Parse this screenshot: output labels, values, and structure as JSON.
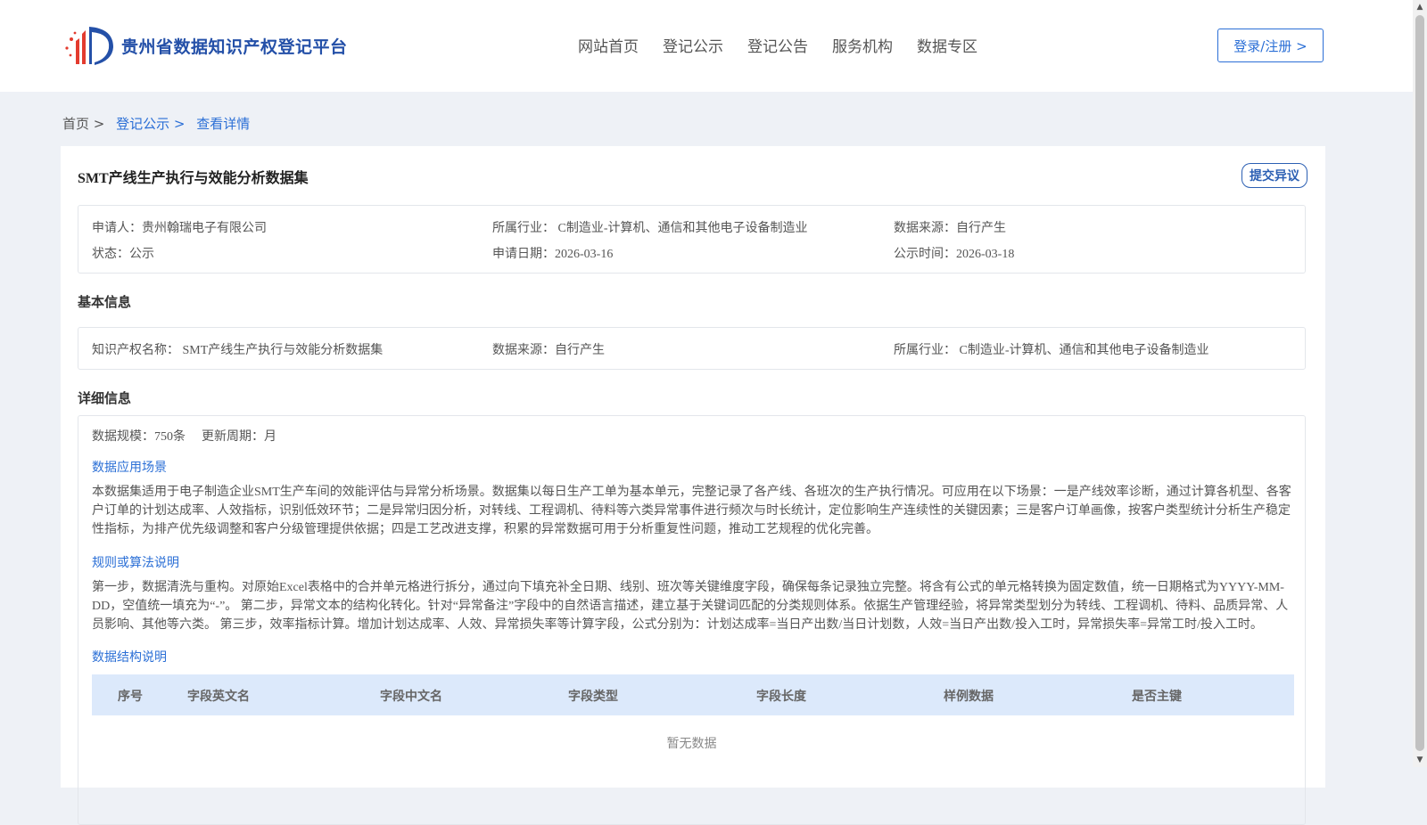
{
  "header": {
    "logo_text": "贵州省数据知识产权登记平台",
    "nav": [
      "网站首页",
      "登记公示",
      "登记公告",
      "服务机构",
      "数据专区"
    ],
    "login_label": "登录/注册 >"
  },
  "breadcrumb": {
    "home": "首页 >",
    "section": "登记公示 >",
    "current": "查看详情"
  },
  "record": {
    "title": "SMT产线生产执行与效能分析数据集",
    "objection_label": "提交异议",
    "summary": {
      "applicant": "申请人：贵州翰瑞电子有限公司",
      "industry": "所属行业： C制造业-计算机、通信和其他电子设备制造业",
      "source": "数据来源：自行产生",
      "status": "状态：公示",
      "apply_date": "申请日期：2026-03-16",
      "publish_date": "公示时间：2026-03-18"
    },
    "basic_heading": "基本信息",
    "basic": {
      "ip_name": "知识产权名称： SMT产线生产执行与效能分析数据集",
      "source": "数据来源：自行产生",
      "industry": "所属行业： C制造业-计算机、通信和其他电子设备制造业"
    },
    "detail_heading": "详细信息",
    "detail": {
      "scale": "数据规模：750条",
      "cycle": "更新周期：月",
      "scenario_heading": "数据应用场景",
      "scenario_text": "本数据集适用于电子制造企业SMT生产车间的效能评估与异常分析场景。数据集以每日生产工单为基本单元，完整记录了各产线、各班次的生产执行情况。可应用在以下场景：一是产线效率诊断，通过计算各机型、各客户订单的计划达成率、人效指标，识别低效环节；二是异常归因分析，对转线、工程调机、待料等六类异常事件进行频次与时长统计，定位影响生产连续性的关键因素；三是客户订单画像，按客户类型统计分析生产稳定性指标，为排产优先级调整和客户分级管理提供依据；四是工艺改进支撑，积累的异常数据可用于分析重复性问题，推动工艺规程的优化完善。",
      "rule_heading": "规则或算法说明",
      "rule_text": "第一步，数据清洗与重构。对原始Excel表格中的合并单元格进行拆分，通过向下填充补全日期、线别、班次等关键维度字段，确保每条记录独立完整。将含有公式的单元格转换为固定数值，统一日期格式为YYYY-MM-DD，空值统一填充为“-”。 第二步，异常文本的结构化转化。针对“异常备注”字段中的自然语言描述，建立基于关键词匹配的分类规则体系。依据生产管理经验，将异常类型划分为转线、工程调机、待料、品质异常、人员影响、其他等六类。 第三步，效率指标计算。增加计划达成率、人效、异常损失率等计算字段，公式分别为：计划达成率=当日产出数/当日计划数，人效=当日产出数/投入工时，异常损失率=异常工时/投入工时。",
      "structure_heading": "数据结构说明",
      "table_headers": [
        "序号",
        "字段英文名",
        "字段中文名",
        "字段类型",
        "字段长度",
        "样例数据",
        "是否主键"
      ],
      "empty_text": "暂无数据"
    }
  },
  "icons": {
    "scroll_up": "▲",
    "scroll_down": "▼"
  }
}
